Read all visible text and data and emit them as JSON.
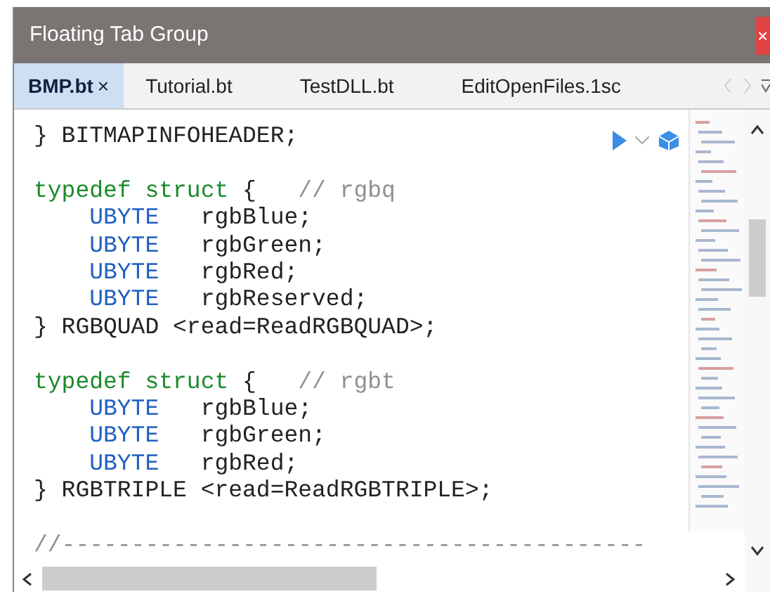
{
  "window": {
    "title": "Floating Tab Group",
    "close": "×"
  },
  "tabs": [
    {
      "label": "BMP.bt",
      "selected": true,
      "close": "×"
    },
    {
      "label": "Tutorial.bt",
      "selected": false
    },
    {
      "label": "TestDLL.bt",
      "selected": false
    },
    {
      "label": "EditOpenFiles.1sc",
      "selected": false
    }
  ],
  "code_blocks": [
    {
      "lines": [
        {
          "indent": false,
          "tokens": [
            {
              "kind": "plain",
              "text": "} BITMAPINFOHEADER;"
            }
          ]
        }
      ]
    },
    {
      "lines": [
        {
          "indent": false,
          "tokens": [
            {
              "kind": "keyword",
              "text": "typedef struct"
            },
            {
              "kind": "plain",
              "text": " {   "
            },
            {
              "kind": "comment",
              "text": "// rgbq"
            }
          ]
        },
        {
          "indent": true,
          "tokens": [
            {
              "kind": "type",
              "text": "UBYTE"
            },
            {
              "kind": "plain",
              "text": "   rgbBlue;"
            }
          ]
        },
        {
          "indent": true,
          "tokens": [
            {
              "kind": "type",
              "text": "UBYTE"
            },
            {
              "kind": "plain",
              "text": "   rgbGreen;"
            }
          ]
        },
        {
          "indent": true,
          "tokens": [
            {
              "kind": "type",
              "text": "UBYTE"
            },
            {
              "kind": "plain",
              "text": "   rgbRed;"
            }
          ]
        },
        {
          "indent": true,
          "tokens": [
            {
              "kind": "type",
              "text": "UBYTE"
            },
            {
              "kind": "plain",
              "text": "   rgbReserved;"
            }
          ]
        },
        {
          "indent": false,
          "tokens": [
            {
              "kind": "plain",
              "text": "} RGBQUAD <read=ReadRGBQUAD>;"
            }
          ]
        }
      ]
    },
    {
      "lines": [
        {
          "indent": false,
          "tokens": [
            {
              "kind": "keyword",
              "text": "typedef struct"
            },
            {
              "kind": "plain",
              "text": " {   "
            },
            {
              "kind": "comment",
              "text": "// rgbt"
            }
          ]
        },
        {
          "indent": true,
          "tokens": [
            {
              "kind": "type",
              "text": "UBYTE"
            },
            {
              "kind": "plain",
              "text": "   rgbBlue;"
            }
          ]
        },
        {
          "indent": true,
          "tokens": [
            {
              "kind": "type",
              "text": "UBYTE"
            },
            {
              "kind": "plain",
              "text": "   rgbGreen;"
            }
          ]
        },
        {
          "indent": true,
          "tokens": [
            {
              "kind": "type",
              "text": "UBYTE"
            },
            {
              "kind": "plain",
              "text": "   rgbRed;"
            }
          ]
        },
        {
          "indent": false,
          "tokens": [
            {
              "kind": "plain",
              "text": "} RGBTRIPLE <read=ReadRGBTRIPLE>;"
            }
          ]
        }
      ]
    },
    {
      "lines": [
        {
          "indent": false,
          "tokens": [
            {
              "kind": "comment",
              "text": "//------------------------------------------"
            }
          ]
        }
      ]
    }
  ]
}
